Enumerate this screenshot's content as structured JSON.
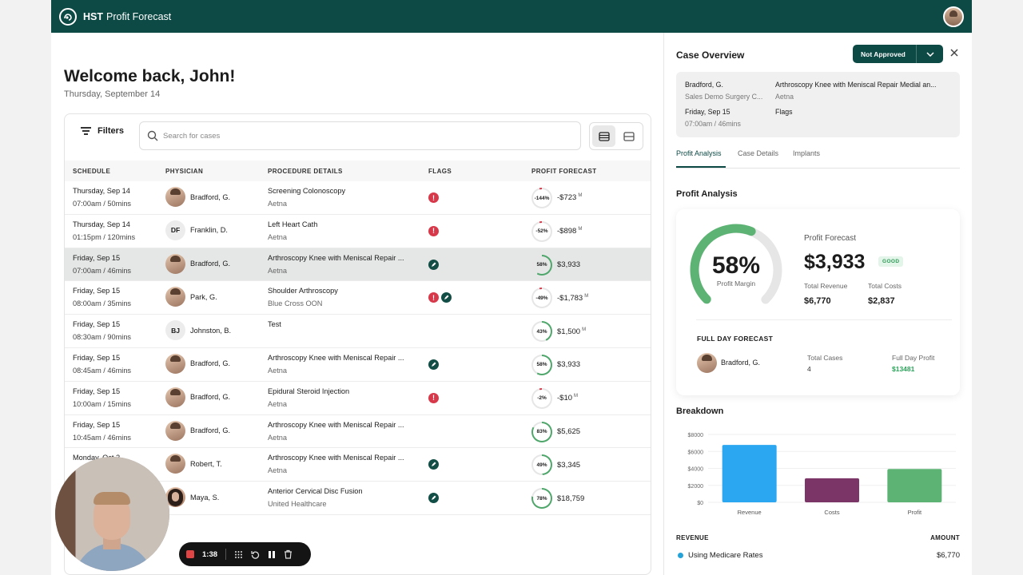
{
  "app": {
    "brand": "HST",
    "title": "Profit Forecast"
  },
  "welcome": "Welcome back, John!",
  "today": "Thursday, September 14",
  "toolbar": {
    "filters": "Filters",
    "search_placeholder": "Search for cases"
  },
  "columns": [
    "SCHEDULE",
    "PHYSICIAN",
    "PROCEDURE DETAILS",
    "FLAGS",
    "PROFIT FORECAST"
  ],
  "cases": [
    {
      "date": "Thursday, Sep 14",
      "time": "07:00am / 50mins",
      "physician": "Bradford, G.",
      "avatar": "photo",
      "procedure": "Screening Colonoscopy",
      "payer": "Aetna",
      "flags": [
        "alert"
      ],
      "pct": "-144%",
      "margin": -144,
      "amount": "-$723",
      "m": "M"
    },
    {
      "date": "Thursday, Sep 14",
      "time": "01:15pm / 120mins",
      "physician": "Franklin, D.",
      "avatar": "DF",
      "procedure": "Left Heart Cath",
      "payer": "Aetna",
      "flags": [
        "alert"
      ],
      "pct": "-52%",
      "margin": -52,
      "amount": "-$898",
      "m": "M"
    },
    {
      "date": "Friday, Sep 15",
      "time": "07:00am / 46mins",
      "physician": "Bradford, G.",
      "avatar": "photo",
      "procedure": "Arthroscopy Knee with Meniscal Repair ...",
      "payer": "Aetna",
      "flags": [
        "edit"
      ],
      "pct": "58%",
      "margin": 58,
      "amount": "$3,933",
      "m": "",
      "selected": true
    },
    {
      "date": "Friday, Sep 15",
      "time": "08:00am / 35mins",
      "physician": "Park, G.",
      "avatar": "photo",
      "procedure": "Shoulder Arthroscopy",
      "payer": "Blue Cross OON",
      "flags": [
        "alert",
        "edit"
      ],
      "pct": "-49%",
      "margin": -49,
      "amount": "-$1,783",
      "m": "M"
    },
    {
      "date": "Friday, Sep 15",
      "time": "08:30am / 90mins",
      "physician": "Johnston, B.",
      "avatar": "BJ",
      "procedure": "Test",
      "payer": "",
      "flags": [],
      "pct": "43%",
      "margin": 43,
      "amount": "$1,500",
      "m": "M"
    },
    {
      "date": "Friday, Sep 15",
      "time": "08:45am / 46mins",
      "physician": "Bradford, G.",
      "avatar": "photo",
      "procedure": "Arthroscopy Knee with Meniscal Repair ...",
      "payer": "Aetna",
      "flags": [
        "edit"
      ],
      "pct": "58%",
      "margin": 58,
      "amount": "$3,933",
      "m": ""
    },
    {
      "date": "Friday, Sep 15",
      "time": "10:00am / 15mins",
      "physician": "Bradford, G.",
      "avatar": "photo",
      "procedure": "Epidural Steroid Injection",
      "payer": "Aetna",
      "flags": [
        "alert"
      ],
      "pct": "-2%",
      "margin": -2,
      "amount": "-$10",
      "m": "M"
    },
    {
      "date": "Friday, Sep 15",
      "time": "10:45am / 46mins",
      "physician": "Bradford, G.",
      "avatar": "photo",
      "procedure": "Arthroscopy Knee with Meniscal Repair ...",
      "payer": "Aetna",
      "flags": [],
      "pct": "83%",
      "margin": 83,
      "amount": "$5,625",
      "m": ""
    },
    {
      "date": "Monday, Oct 2",
      "time": "",
      "physician": "Robert, T.",
      "avatar": "photo",
      "procedure": "Arthroscopy Knee with Meniscal Repair ...",
      "payer": "Aetna",
      "flags": [
        "edit"
      ],
      "pct": "49%",
      "margin": 49,
      "amount": "$3,345",
      "m": ""
    },
    {
      "date": "",
      "time": "",
      "physician": "Maya, S.",
      "avatar": "photo-f",
      "procedure": "Anterior Cervical Disc Fusion",
      "payer": "United Healthcare",
      "flags": [
        "edit"
      ],
      "pct": "78%",
      "margin": 78,
      "amount": "$18,759",
      "m": ""
    }
  ],
  "overview": {
    "title": "Case Overview",
    "status": "Not Approved",
    "physician": "Bradford, G.",
    "location": "Sales Demo Surgery C...",
    "date": "Friday, Sep 15",
    "time": "07:00am / 46mins",
    "procedure": "Arthroscopy Knee with Meniscal Repair Medial an...",
    "payer": "Aetna",
    "flags_label": "Flags"
  },
  "tabs": [
    "Profit Analysis",
    "Case Details",
    "Implants"
  ],
  "analysis": {
    "title": "Profit Analysis",
    "margin_pct": "58%",
    "margin_value": 58,
    "margin_label": "Profit Margin",
    "forecast_label": "Profit Forecast",
    "forecast_value": "$3,933",
    "badge": "GOOD",
    "revenue_label": "Total Revenue",
    "revenue_value": "$6,770",
    "costs_label": "Total Costs",
    "costs_value": "$2,837",
    "full_day_title": "FULL DAY FORECAST",
    "full_day_physician": "Bradford, G.",
    "total_cases_label": "Total Cases",
    "total_cases_value": "4",
    "full_day_profit_label": "Full Day Profit",
    "full_day_profit_value": "$13481"
  },
  "breakdown_title": "Breakdown",
  "chart_data": {
    "type": "bar",
    "categories": [
      "Revenue",
      "Costs",
      "Profit"
    ],
    "values": [
      6770,
      2837,
      3933
    ],
    "colors": [
      "#2aa7f0",
      "#7b3566",
      "#5db374"
    ],
    "yticks": [
      "$8000",
      "$6000",
      "$4000",
      "$2000",
      "$0"
    ],
    "ylim": [
      0,
      8000
    ]
  },
  "revenue_table": {
    "head_left": "REVENUE",
    "head_right": "AMOUNT",
    "rows": [
      {
        "label": "Using Medicare Rates",
        "amount": "$6,770"
      }
    ]
  },
  "recording": {
    "time": "1:38"
  }
}
